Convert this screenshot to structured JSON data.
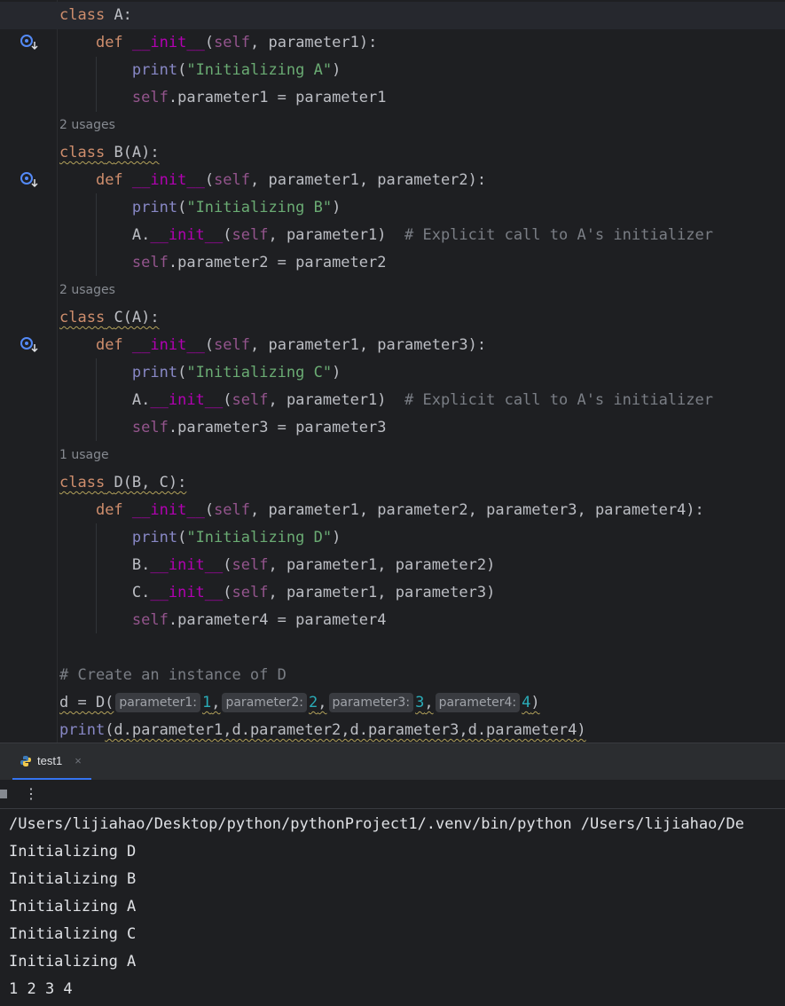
{
  "code": {
    "l1": {
      "kw": "class",
      "name": "A:"
    },
    "l2": {
      "kw": "def",
      "fn": "__init__",
      "open": "(",
      "self": "self",
      "rest": ", parameter1):"
    },
    "l3": {
      "print": "print",
      "open": "(",
      "str": "\"Initializing A\"",
      "close": ")"
    },
    "l4": {
      "self": "self",
      "rest": ".parameter1 = parameter1"
    },
    "hint_b": "2 usages",
    "l5": {
      "kw": "class",
      "name": "B(A):"
    },
    "l6": {
      "kw": "def",
      "fn": "__init__",
      "open": "(",
      "self": "self",
      "rest": ", parameter1, parameter2):"
    },
    "l7": {
      "print": "print",
      "open": "(",
      "str": "\"Initializing B\"",
      "close": ")"
    },
    "l8": {
      "obj": "A.",
      "fn": "__init__",
      "open": "(",
      "self": "self",
      "rest": ", parameter1)  ",
      "cmt": "# Explicit call to A's initializer"
    },
    "l9": {
      "self": "self",
      "rest": ".parameter2 = parameter2"
    },
    "hint_c": "2 usages",
    "l10": {
      "kw": "class",
      "name": "C(A):"
    },
    "l11": {
      "kw": "def",
      "fn": "__init__",
      "open": "(",
      "self": "self",
      "rest": ", parameter1, parameter3):"
    },
    "l12": {
      "print": "print",
      "open": "(",
      "str": "\"Initializing C\"",
      "close": ")"
    },
    "l13": {
      "obj": "A.",
      "fn": "__init__",
      "open": "(",
      "self": "self",
      "rest": ", parameter1)  ",
      "cmt": "# Explicit call to A's initializer"
    },
    "l14": {
      "self": "self",
      "rest": ".parameter3 = parameter3"
    },
    "hint_d": "1 usage",
    "l15": {
      "kw": "class",
      "name": "D(B, C):"
    },
    "l16": {
      "kw": "def",
      "fn": "__init__",
      "open": "(",
      "self": "self",
      "rest": ", parameter1, parameter2, parameter3, parameter4):"
    },
    "l17": {
      "print": "print",
      "open": "(",
      "str": "\"Initializing D\"",
      "close": ")"
    },
    "l18": {
      "obj": "B.",
      "fn": "__init__",
      "open": "(",
      "self": "self",
      "rest": ", parameter1, parameter2)"
    },
    "l19": {
      "obj": "C.",
      "fn": "__init__",
      "open": "(",
      "self": "self",
      "rest": ", parameter1, parameter3)"
    },
    "l20": {
      "self": "self",
      "rest": ".parameter4 = parameter4"
    },
    "l21": {
      "cmt": "# Create an instance of D"
    },
    "l22": {
      "pre": "d = D(",
      "h1": "parameter1:",
      "v1": "1",
      "h2": "parameter2:",
      "v2": "2",
      "h3": "parameter3:",
      "v3": "3",
      "h4": "parameter4:",
      "v4": "4",
      "close": ")"
    },
    "l23": {
      "print": "print",
      "rest": "(d.parameter1,d.parameter2,d.parameter3,d.parameter4)"
    }
  },
  "run_panel": {
    "tab_label": "test1",
    "close_glyph": "×",
    "menu_glyph": "⋮",
    "output": [
      "/Users/lijiahao/Desktop/python/pythonProject1/.venv/bin/python /Users/lijiahao/De",
      "Initializing D",
      "Initializing B",
      "Initializing A",
      "Initializing C",
      "Initializing A",
      "1 2 3 4"
    ]
  },
  "colors": {
    "background": "#1e1f22",
    "keyword": "#cf8e6d",
    "string": "#6aab73",
    "self": "#94558d",
    "accent": "#3574f0"
  }
}
